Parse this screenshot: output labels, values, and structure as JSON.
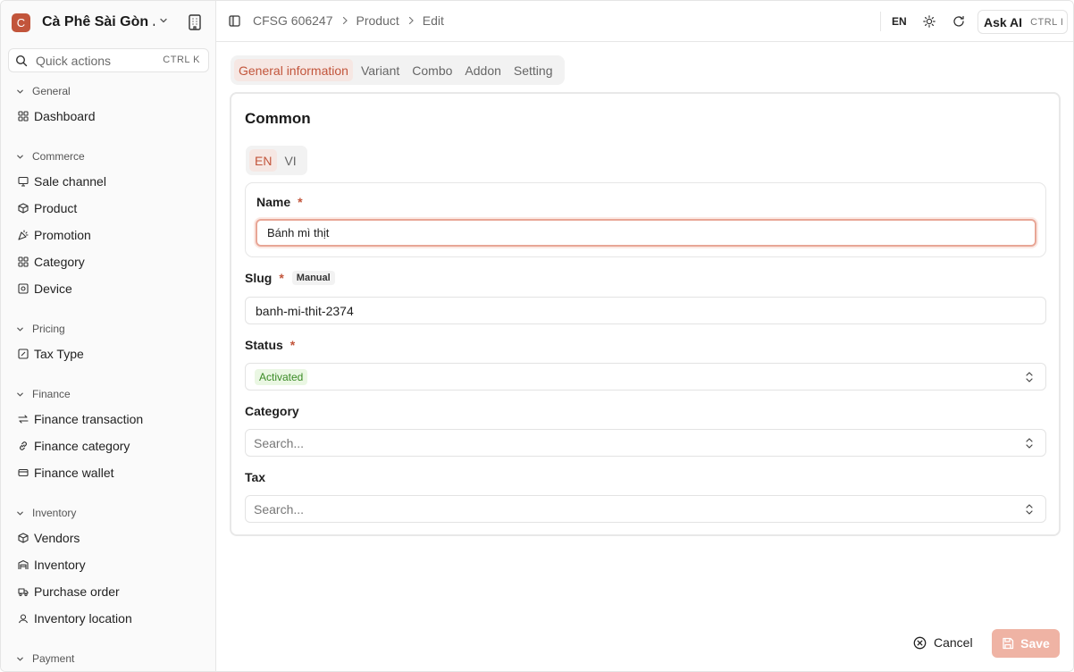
{
  "org": {
    "initial": "C",
    "name": "Cà Phê Sài Gòn ..."
  },
  "quick_actions": {
    "label": "Quick actions",
    "shortcut": "CTRL K"
  },
  "sidebar": {
    "groups": [
      {
        "title": "General",
        "items": [
          {
            "label": "Dashboard",
            "icon": "grid-icon"
          }
        ]
      },
      {
        "title": "Commerce",
        "items": [
          {
            "label": "Sale channel",
            "icon": "monitor-icon"
          },
          {
            "label": "Product",
            "icon": "box-icon"
          },
          {
            "label": "Promotion",
            "icon": "party-icon"
          },
          {
            "label": "Category",
            "icon": "grid-icon"
          },
          {
            "label": "Device",
            "icon": "device-icon"
          }
        ]
      },
      {
        "title": "Pricing",
        "items": [
          {
            "label": "Tax Type",
            "icon": "percent-square-icon"
          }
        ]
      },
      {
        "title": "Finance",
        "items": [
          {
            "label": "Finance transaction",
            "icon": "arrows-icon"
          },
          {
            "label": "Finance category",
            "icon": "link-icon"
          },
          {
            "label": "Finance wallet",
            "icon": "wallet-icon"
          }
        ]
      },
      {
        "title": "Inventory",
        "items": [
          {
            "label": "Vendors",
            "icon": "box-icon"
          },
          {
            "label": "Inventory",
            "icon": "warehouse-icon"
          },
          {
            "label": "Purchase order",
            "icon": "truck-icon"
          },
          {
            "label": "Inventory location",
            "icon": "pin-icon"
          }
        ]
      },
      {
        "title": "Payment",
        "items": []
      }
    ]
  },
  "breadcrumb": {
    "items": [
      "CFSG 606247",
      "Product",
      "Edit"
    ]
  },
  "topbar": {
    "language": "EN",
    "ask_ai": "Ask AI",
    "ask_ai_shortcut": "CTRL I"
  },
  "tabs": [
    "General information",
    "Variant",
    "Combo",
    "Addon",
    "Setting"
  ],
  "form": {
    "section_title": "Common",
    "languages": [
      "EN",
      "VI"
    ],
    "name": {
      "label": "Name",
      "required_mark": "*",
      "value": "Bánh mì thịt"
    },
    "slug": {
      "label": "Slug",
      "required_mark": "*",
      "mode": "Manual",
      "value": "banh-mi-thit-2374"
    },
    "status": {
      "label": "Status",
      "required_mark": "*",
      "value": "Activated"
    },
    "category": {
      "label": "Category",
      "placeholder": "Search..."
    },
    "tax": {
      "label": "Tax",
      "placeholder": "Search..."
    }
  },
  "actions": {
    "cancel": "Cancel",
    "save": "Save"
  },
  "colors": {
    "accent": "#c2553b",
    "accent_soft": "#f6e7e3",
    "save_disabled": "#efb3a4",
    "status_green": "#3a8a25"
  }
}
